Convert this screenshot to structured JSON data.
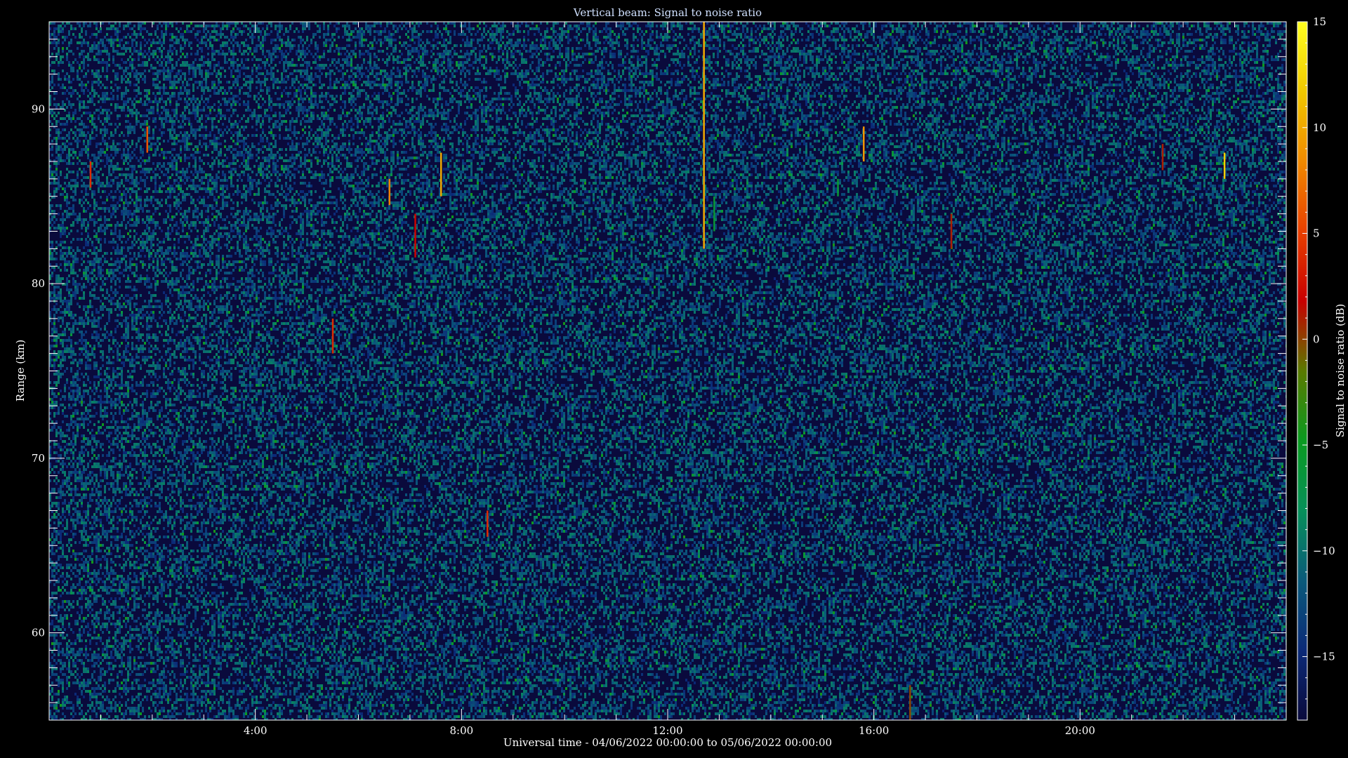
{
  "chart_data": {
    "type": "heatmap",
    "title": "Vertical beam: Signal to noise ratio",
    "xlabel": "Universal time - 04/06/2022 00:00:00 to 05/06/2022 00:00:00",
    "ylabel": "Range (km)",
    "colorbar_label": "Signal to noise ratio (dB)",
    "x_range_hours": [
      0,
      24
    ],
    "y_range_km": [
      55,
      95
    ],
    "x_ticks": [
      {
        "value": 4,
        "label": "4:00"
      },
      {
        "value": 8,
        "label": "8:00"
      },
      {
        "value": 12,
        "label": "12:00"
      },
      {
        "value": 16,
        "label": "16:00"
      },
      {
        "value": 20,
        "label": "20:00"
      }
    ],
    "y_ticks": [
      {
        "value": 60,
        "label": "60"
      },
      {
        "value": 70,
        "label": "70"
      },
      {
        "value": 80,
        "label": "80"
      },
      {
        "value": 90,
        "label": "90"
      }
    ],
    "colorbar_range_db": [
      -18,
      15
    ],
    "colorbar_ticks": [
      {
        "value": 15,
        "label": "15"
      },
      {
        "value": 10,
        "label": "10"
      },
      {
        "value": 5,
        "label": "5"
      },
      {
        "value": 0,
        "label": "0"
      },
      {
        "value": -5,
        "label": "−5"
      },
      {
        "value": -10,
        "label": "−10"
      },
      {
        "value": -15,
        "label": "−15"
      }
    ],
    "colormap": [
      "#0a0a3c",
      "#0b2a78",
      "#0a5a7a",
      "#07905a",
      "#0a9a20",
      "#5a7a00",
      "#c80000",
      "#e84000",
      "#f08a00",
      "#f0c800",
      "#ffff20"
    ],
    "background_db": -15,
    "notable_echoes": [
      {
        "t": 12.7,
        "r_top": 95,
        "r_bottom": 82,
        "db": 10
      },
      {
        "t": 12.9,
        "r_top": 85,
        "r_bottom": 83,
        "db": -6
      },
      {
        "t": 15.3,
        "r_top": 86,
        "r_bottom": 85,
        "db": -6
      },
      {
        "t": 15.8,
        "r_top": 89,
        "r_bottom": 87,
        "db": 9
      },
      {
        "t": 7.6,
        "r_top": 87.5,
        "r_bottom": 85,
        "db": 10
      },
      {
        "t": 7.1,
        "r_top": 84,
        "r_bottom": 81.5,
        "db": 2
      },
      {
        "t": 5.5,
        "r_top": 78,
        "r_bottom": 76,
        "db": 4
      },
      {
        "t": 16.7,
        "r_top": 57,
        "r_bottom": 55,
        "db": 0
      },
      {
        "t": 22.8,
        "r_top": 87.5,
        "r_bottom": 86,
        "db": 12
      },
      {
        "t": 8.5,
        "r_top": 67,
        "r_bottom": 65.5,
        "db": 4
      },
      {
        "t": 0.8,
        "r_top": 87,
        "r_bottom": 85.5,
        "db": 4
      },
      {
        "t": 1.9,
        "r_top": 89,
        "r_bottom": 87.5,
        "db": 6
      },
      {
        "t": 6.6,
        "r_top": 86,
        "r_bottom": 84.5,
        "db": 8
      },
      {
        "t": 17.5,
        "r_top": 84,
        "r_bottom": 82,
        "db": 1
      },
      {
        "t": 21.6,
        "r_top": 88,
        "r_bottom": 86.5,
        "db": 1
      }
    ]
  }
}
